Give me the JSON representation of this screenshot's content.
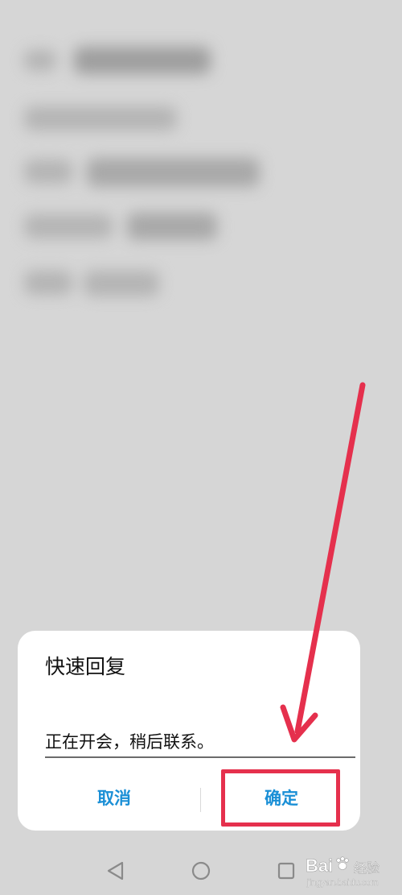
{
  "dialog": {
    "title": "快速回复",
    "input_value": "正在开会，稍后联系。",
    "cancel_label": "取消",
    "confirm_label": "确定"
  },
  "icons": {
    "nav_back": "back-triangle-icon",
    "nav_home": "home-circle-icon",
    "nav_recent": "recent-square-icon"
  },
  "watermark": {
    "logo": "Bai",
    "label": "经验",
    "sub": "jingyan.baidu.com"
  },
  "colors": {
    "accent": "#1a8fd6",
    "highlight": "#e5304d",
    "dialog_bg": "#ffffff",
    "screen_bg": "#d6d6d6"
  }
}
